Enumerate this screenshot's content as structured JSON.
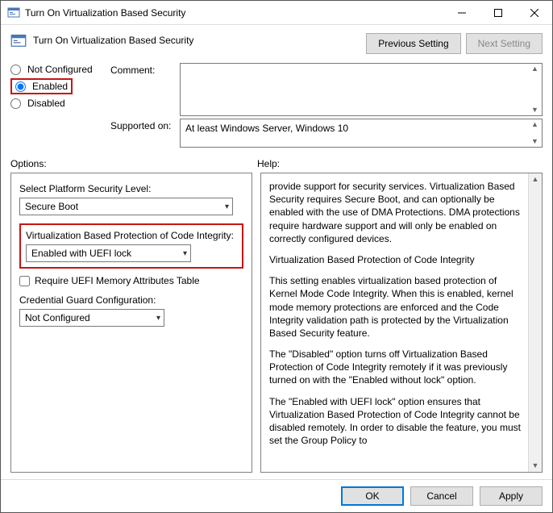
{
  "window": {
    "title": "Turn On Virtualization Based Security"
  },
  "header": {
    "title": "Turn On Virtualization Based Security",
    "prev": "Previous Setting",
    "next": "Next Setting"
  },
  "state_radios": {
    "not_configured": "Not Configured",
    "enabled": "Enabled",
    "disabled": "Disabled"
  },
  "labels": {
    "comment": "Comment:",
    "supported": "Supported on:",
    "options": "Options:",
    "help": "Help:"
  },
  "supported_value": "At least Windows Server, Windows 10",
  "options": {
    "platform_label": "Select Platform Security Level:",
    "platform_value": "Secure Boot",
    "vbp_label": "Virtualization Based Protection of Code Integrity:",
    "vbp_value": "Enabled with UEFI lock",
    "require_mat": "Require UEFI Memory Attributes Table",
    "cred_label": "Credential Guard Configuration:",
    "cred_value": "Not Configured"
  },
  "help": {
    "p1": "provide support for security services. Virtualization Based Security requires Secure Boot, and can optionally be enabled with the use of DMA Protections. DMA protections require hardware support and will only be enabled on correctly configured devices.",
    "h1": "Virtualization Based Protection of Code Integrity",
    "p2": "This setting enables virtualization based protection of Kernel Mode Code Integrity. When this is enabled, kernel mode memory protections are enforced and the Code Integrity validation path is protected by the Virtualization Based Security feature.",
    "p3": "The \"Disabled\" option turns off Virtualization Based Protection of Code Integrity remotely if it was previously turned on with the \"Enabled without lock\" option.",
    "p4": "The \"Enabled with UEFI lock\" option ensures that Virtualization Based Protection of Code Integrity cannot be disabled remotely. In order to disable the feature, you must set the Group Policy to"
  },
  "footer": {
    "ok": "OK",
    "cancel": "Cancel",
    "apply": "Apply"
  }
}
